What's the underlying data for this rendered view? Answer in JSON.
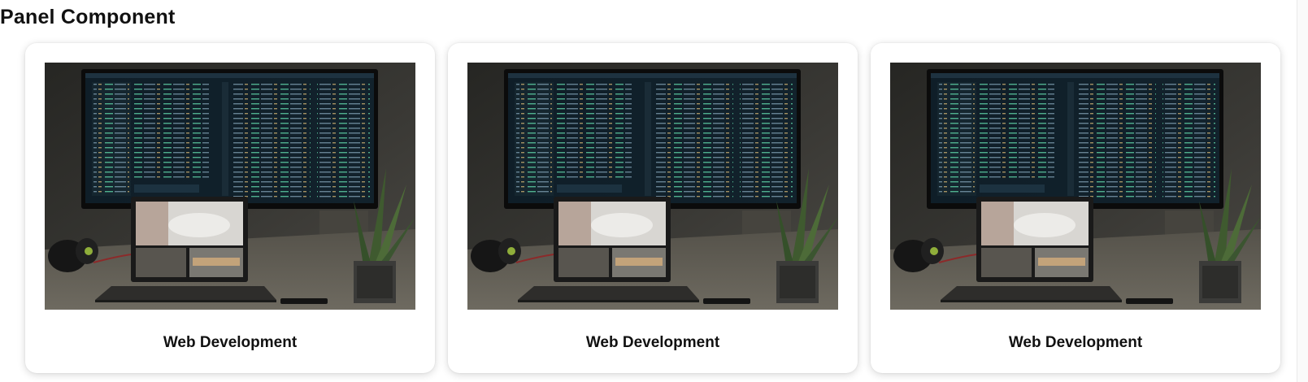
{
  "page": {
    "title": "Panel Component"
  },
  "panels": [
    {
      "title": "Web Development",
      "image": "developer-desk-photo"
    },
    {
      "title": "Web Development",
      "image": "developer-desk-photo"
    },
    {
      "title": "Web Development",
      "image": "developer-desk-photo"
    }
  ],
  "colors": {
    "background": "#ffffff",
    "text": "#111111",
    "photo_dark": "#2b2b29",
    "code_accent": "#5fd3a8"
  }
}
